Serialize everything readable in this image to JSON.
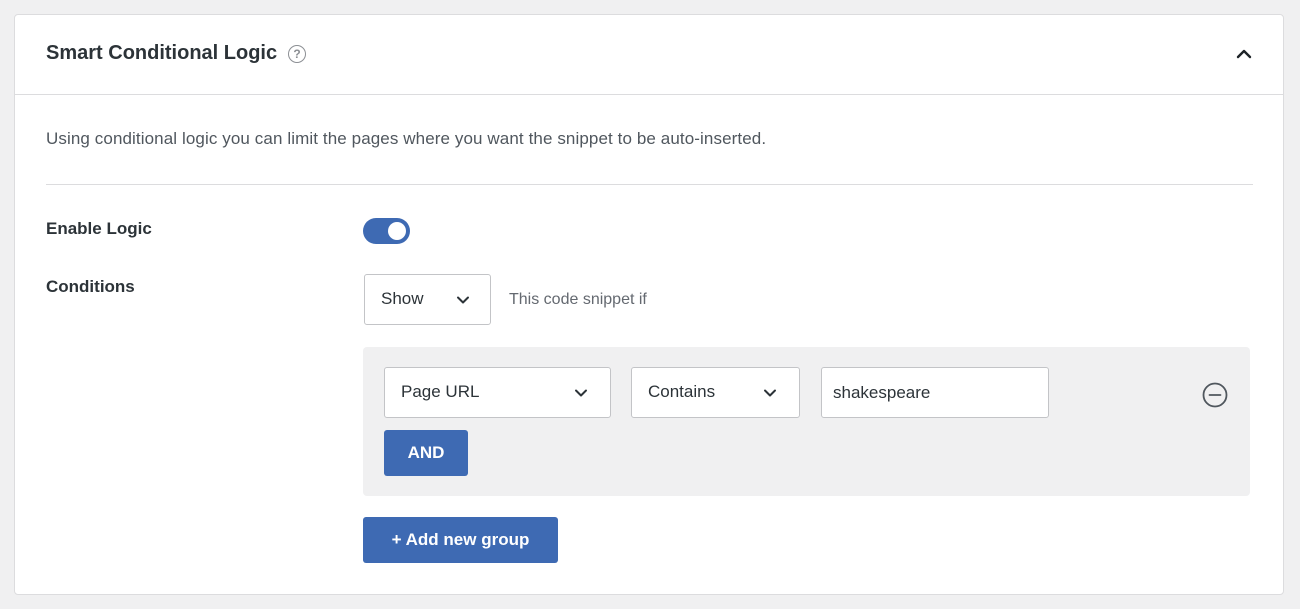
{
  "panel": {
    "title": "Smart Conditional Logic",
    "help_icon": "question-circle-icon",
    "collapse_icon": "chevron-up-icon"
  },
  "description": "Using conditional logic you can limit the pages where you want the snippet to be auto-inserted.",
  "enable_logic": {
    "label": "Enable Logic",
    "enabled": true
  },
  "conditions": {
    "label": "Conditions",
    "visibility_select": "Show",
    "hint": "This code snippet if",
    "group": {
      "rule": {
        "type": "Page URL",
        "operator": "Contains",
        "value": "shakespeare"
      },
      "and_button": "AND",
      "remove_icon": "minus-circle-icon"
    },
    "add_group_button": "+ Add new group"
  },
  "colors": {
    "accent": "#3e6ab3",
    "background": "#f0f0f1",
    "panel": "#ffffff"
  }
}
